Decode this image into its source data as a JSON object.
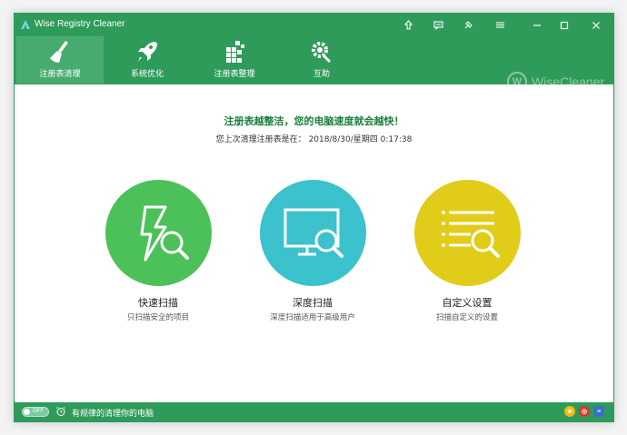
{
  "window": {
    "title": "Wise Registry Cleaner"
  },
  "titlebar_icons": [
    "upgrade-icon",
    "feedback-icon",
    "skin-icon",
    "menu-icon",
    "minimize-icon",
    "maximize-icon",
    "close-icon"
  ],
  "nav": {
    "items": [
      {
        "label": "注册表清理",
        "icon": "broom-icon",
        "active": true
      },
      {
        "label": "系统优化",
        "icon": "rocket-icon",
        "active": false
      },
      {
        "label": "注册表整理",
        "icon": "blocks-icon",
        "active": false
      },
      {
        "label": "互助",
        "icon": "gear-wrench-icon",
        "active": false
      }
    ]
  },
  "brand": {
    "mark": "W",
    "name": "WiseCleaner"
  },
  "main": {
    "headline": "注册表越整洁，您的电脑速度就会越快！",
    "last_clean_label": "您上次清理注册表是在：",
    "last_clean_time": "2018/8/30/星期四 0:17:38"
  },
  "scans": [
    {
      "title": "快速扫描",
      "subtitle": "只扫描安全的项目",
      "color": "#4cc159",
      "icon": "lightning-magnifier-icon"
    },
    {
      "title": "深度扫描",
      "subtitle": "深度扫描适用于高级用户",
      "color": "#3bc2cc",
      "icon": "monitor-magnifier-icon"
    },
    {
      "title": "自定义设置",
      "subtitle": "扫描自定义的设置",
      "color": "#e1cc1a",
      "icon": "list-magnifier-icon"
    }
  ],
  "statusbar": {
    "toggle_label": "OFF",
    "schedule_text": "有规律的清理你的电脑",
    "icons": [
      "star-icon",
      "weibo-icon",
      "website-icon"
    ]
  },
  "colors": {
    "brand_green": "#2f9b5b",
    "active_tab": "#47ab70",
    "headline_green": "#1b7f3d"
  }
}
